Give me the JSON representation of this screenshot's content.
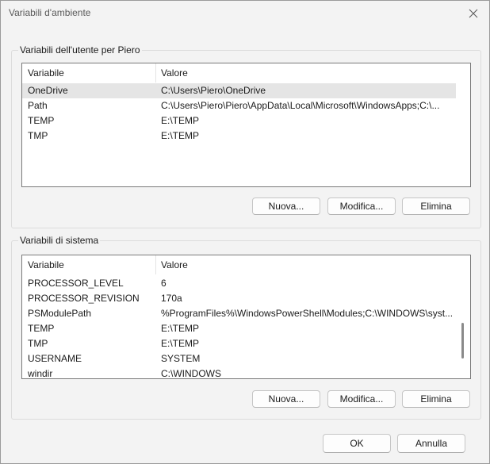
{
  "window": {
    "title": "Variabili d'ambiente"
  },
  "user_group": {
    "label": "Variabili dell'utente per Piero",
    "columns": [
      "Variabile",
      "Valore"
    ],
    "rows": [
      {
        "name": "OneDrive",
        "value": "C:\\Users\\Piero\\OneDrive",
        "selected": true
      },
      {
        "name": "Path",
        "value": "C:\\Users\\Piero\\Piero\\AppData\\Local\\Microsoft\\WindowsApps;C:\\..."
      },
      {
        "name": "TEMP",
        "value": "E:\\TEMP"
      },
      {
        "name": "TMP",
        "value": "E:\\TEMP"
      }
    ],
    "buttons": {
      "new": "Nuova...",
      "edit": "Modifica...",
      "delete": "Elimina"
    }
  },
  "system_group": {
    "label": "Variabili di sistema",
    "columns": [
      "Variabile",
      "Valore"
    ],
    "rows": [
      {
        "name": "PROCESSOR_LEVEL",
        "value": "6"
      },
      {
        "name": "PROCESSOR_REVISION",
        "value": "170a"
      },
      {
        "name": "PSModulePath",
        "value": "%ProgramFiles%\\WindowsPowerShell\\Modules;C:\\WINDOWS\\syst..."
      },
      {
        "name": "TEMP",
        "value": "E:\\TEMP"
      },
      {
        "name": "TMP",
        "value": "E:\\TEMP"
      },
      {
        "name": "USERNAME",
        "value": "SYSTEM"
      },
      {
        "name": "windir",
        "value": "C:\\WINDOWS"
      }
    ],
    "buttons": {
      "new": "Nuova...",
      "edit": "Modifica...",
      "delete": "Elimina"
    }
  },
  "footer": {
    "ok": "OK",
    "cancel": "Annulla"
  },
  "icons": {
    "close": "close-icon"
  }
}
